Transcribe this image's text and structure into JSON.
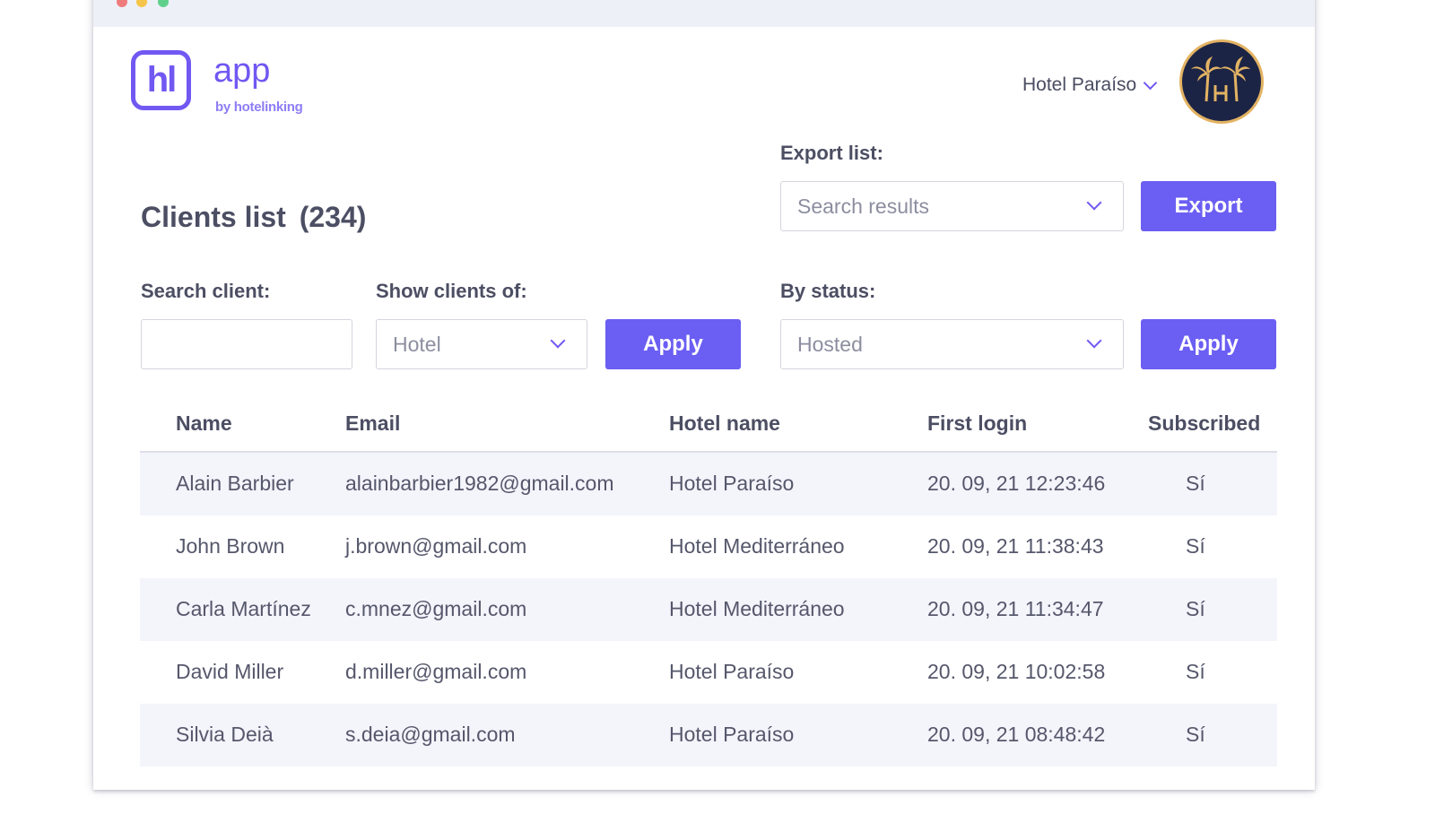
{
  "app": {
    "logo_mark": "hl",
    "logo_name": "app",
    "logo_by": "by hotelinking"
  },
  "header": {
    "hotel_selector": "Hotel Paraíso",
    "avatar_icon": "palm-tree-hotel-logo"
  },
  "export": {
    "label": "Export list:",
    "selected": "Search results",
    "button": "Export"
  },
  "title": {
    "text": "Clients list",
    "count": "(234)"
  },
  "filters": {
    "search_label": "Search client:",
    "search_value": "",
    "show_label": "Show clients of:",
    "show_selected": "Hotel",
    "apply_1": "Apply",
    "status_label": "By status:",
    "status_selected": "Hosted",
    "apply_2": "Apply"
  },
  "table": {
    "columns": [
      "Name",
      "Email",
      "Hotel name",
      "First login",
      "Subscribed"
    ],
    "rows": [
      [
        "Alain Barbier",
        "alainbarbier1982@gmail.com",
        "Hotel Paraíso",
        "20. 09, 21 12:23:46",
        "Sí"
      ],
      [
        "John Brown",
        "j.brown@gmail.com",
        "Hotel Mediterráneo",
        "20. 09, 21 11:38:43",
        "Sí"
      ],
      [
        "Carla Martínez",
        "c.mnez@gmail.com",
        "Hotel Mediterráneo",
        "20. 09, 21 11:34:47",
        "Sí"
      ],
      [
        "David Miller",
        "d.miller@gmail.com",
        "Hotel Paraíso",
        "20. 09, 21 10:02:58",
        "Sí"
      ],
      [
        "Silvia Deià",
        "s.deia@gmail.com",
        "Hotel Paraíso",
        "20. 09, 21 08:48:42",
        "Sí"
      ]
    ]
  },
  "colors": {
    "accent": "#6b5ef3",
    "logo": "#7158f2",
    "row_alt": "#f4f4fb",
    "avatar_bg": "#1c2446",
    "avatar_ring": "#e3b363"
  }
}
